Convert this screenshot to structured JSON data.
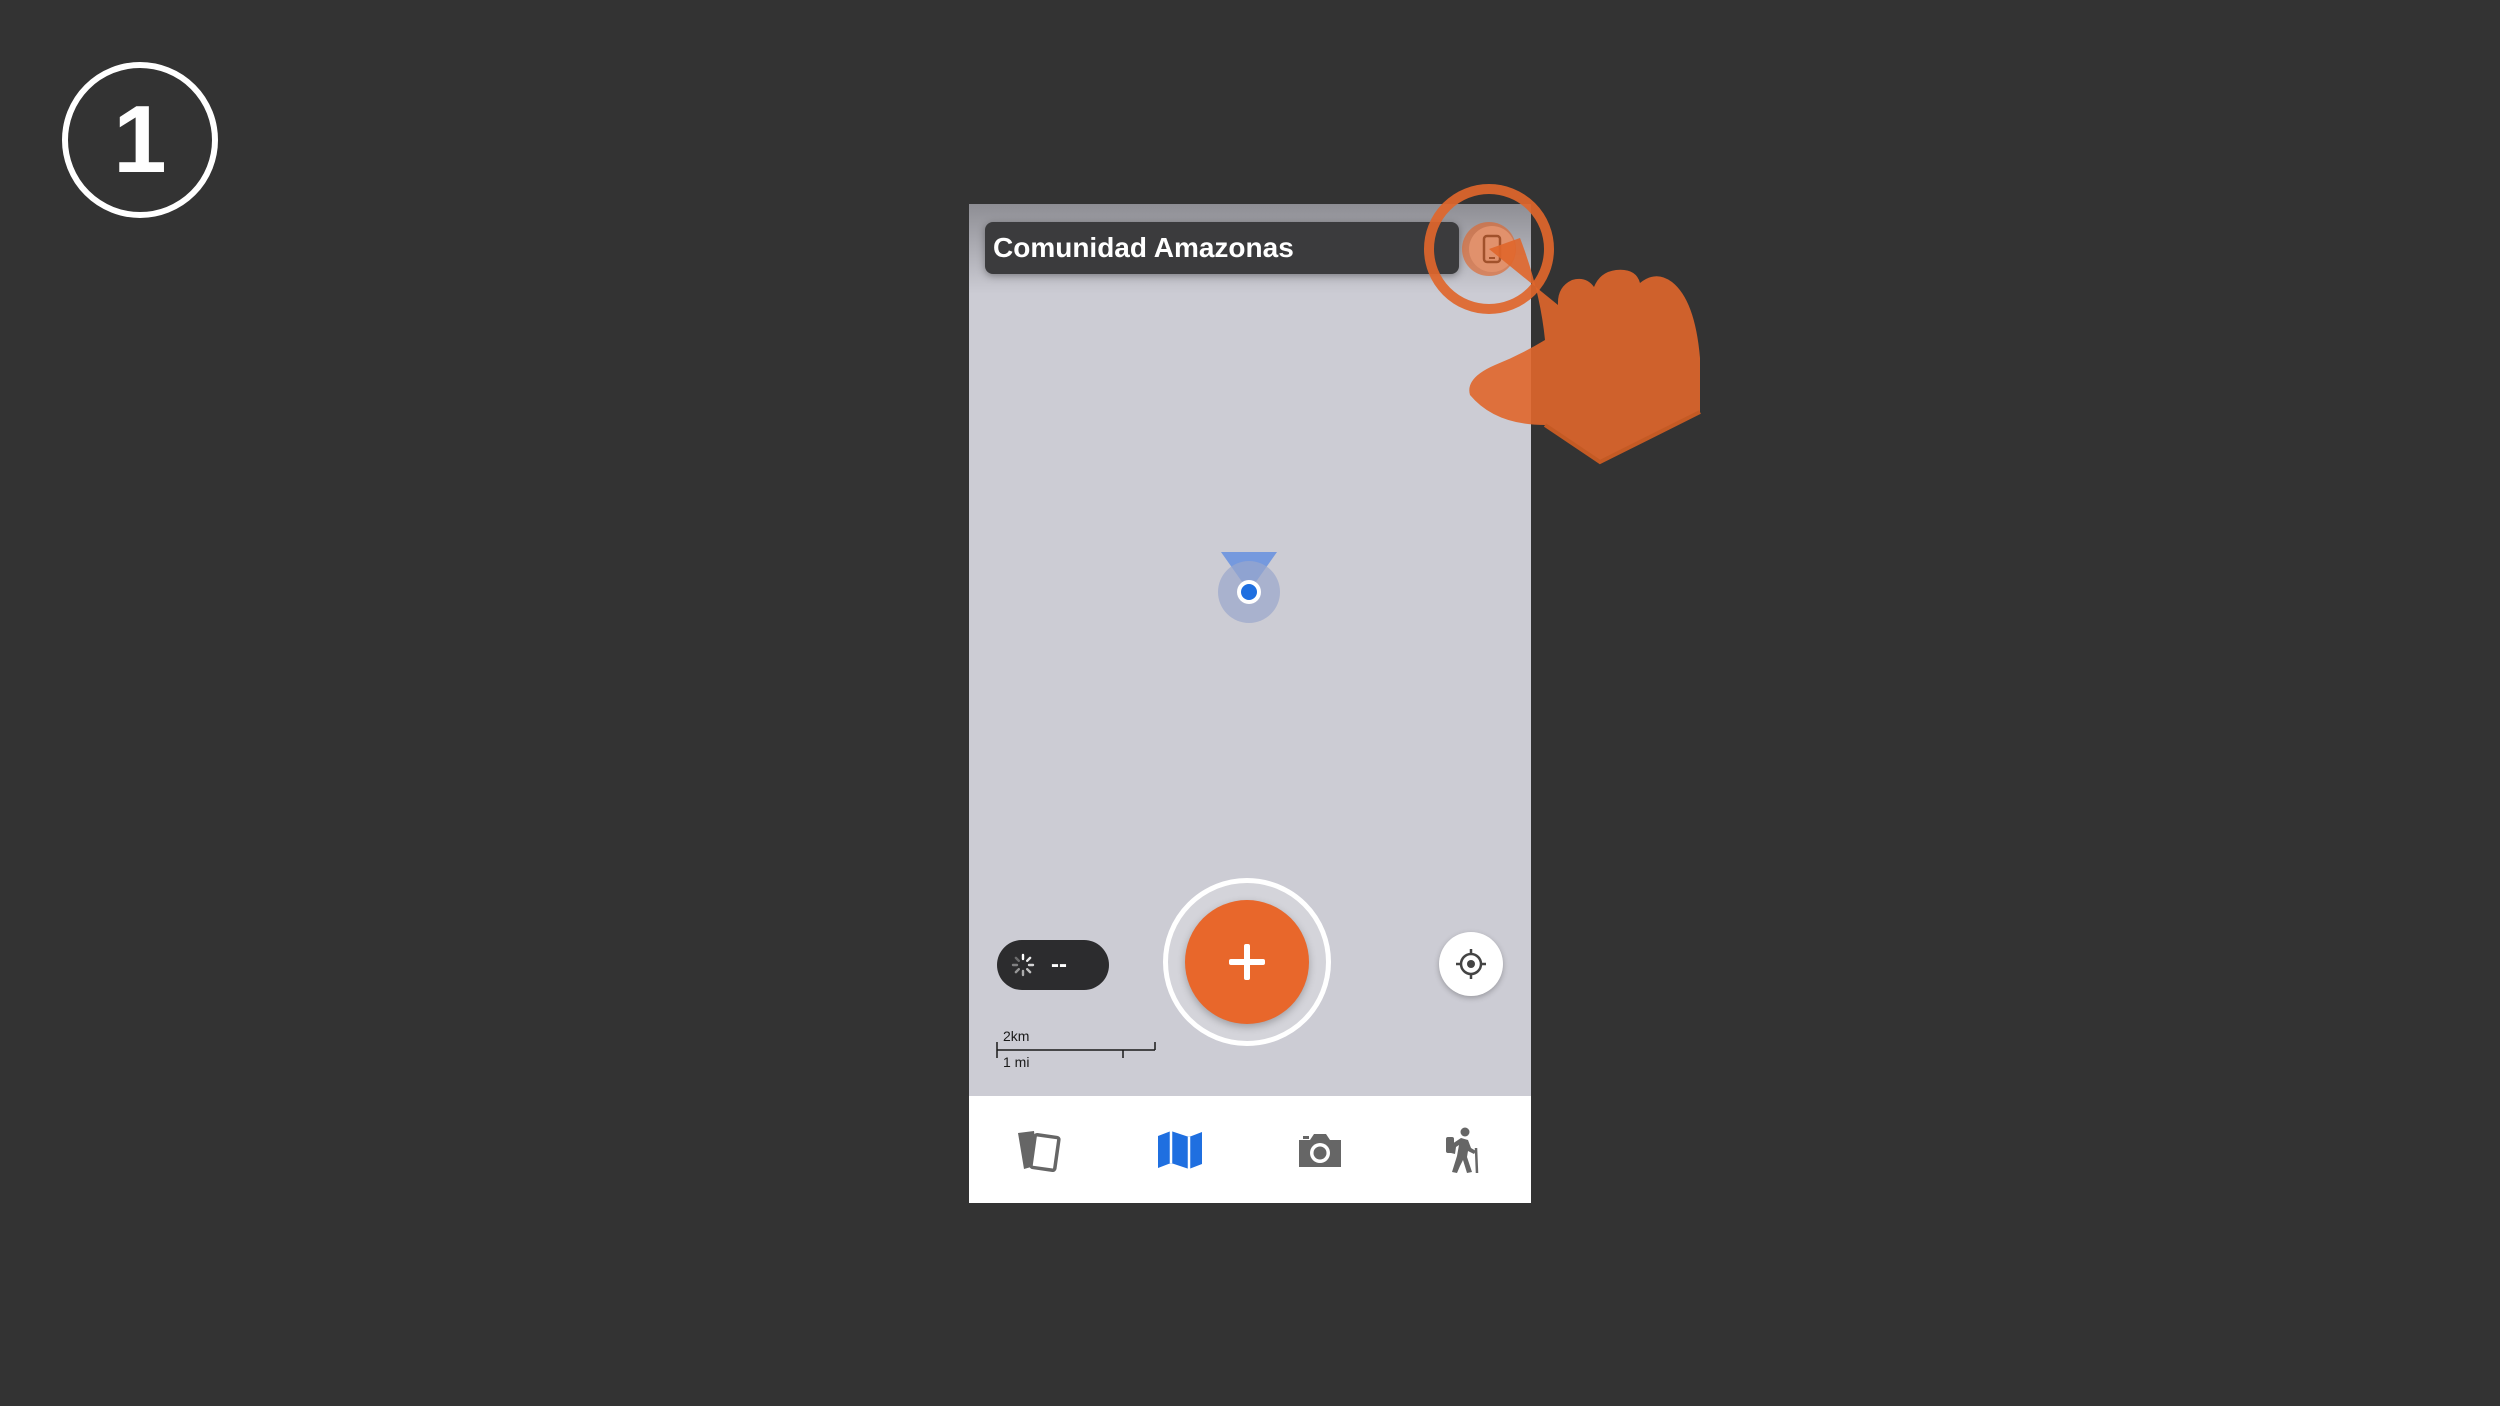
{
  "step": {
    "number": "1"
  },
  "header": {
    "title": "Comunidad Amazonas",
    "device_icon": "phone-icon"
  },
  "map": {
    "gps_status_icon": "spinner-icon",
    "gps_accuracy": "--",
    "scale": {
      "metric": "2km",
      "imperial": "1 mi"
    }
  },
  "actions": {
    "add_icon": "plus-icon",
    "locate_icon": "crosshair-icon"
  },
  "tabs": [
    {
      "name": "cards",
      "icon": "cards-icon",
      "active": false
    },
    {
      "name": "map",
      "icon": "map-icon",
      "active": true
    },
    {
      "name": "camera",
      "icon": "camera-icon",
      "active": false
    },
    {
      "name": "tracks",
      "icon": "hiker-icon",
      "active": false
    }
  ],
  "colors": {
    "accent": "#e8672b",
    "active_tab": "#1f6fe0",
    "inactive_tab": "#666666",
    "background": "#333333",
    "map": "#ccccd4"
  }
}
